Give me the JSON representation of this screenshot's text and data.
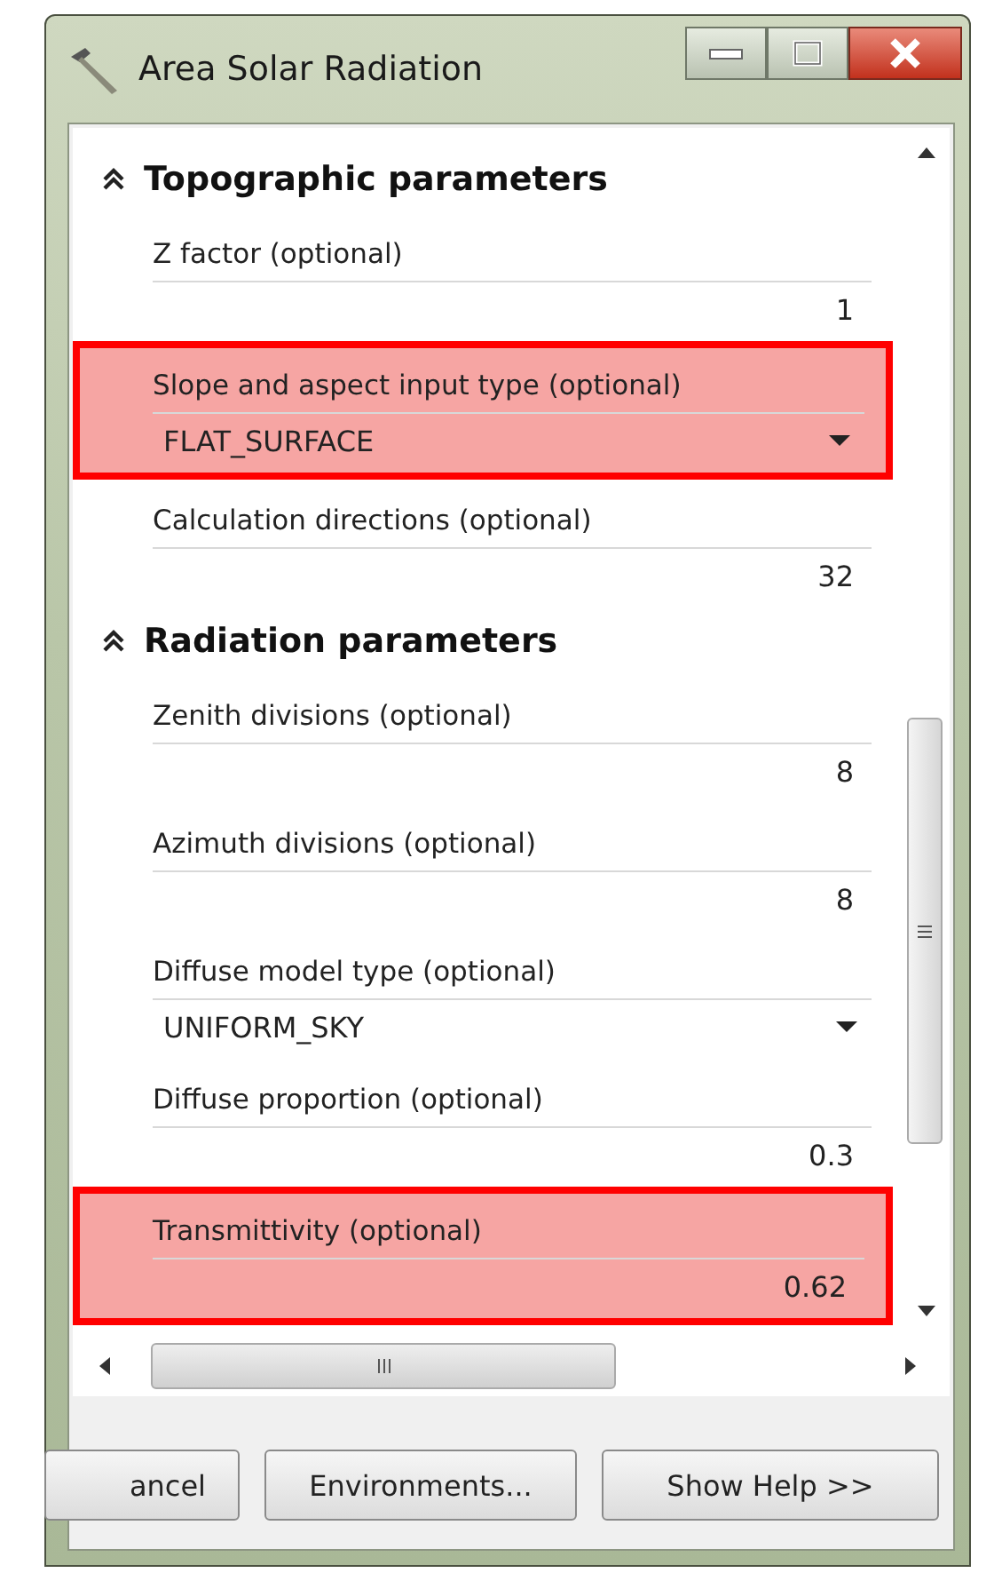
{
  "window": {
    "title": "Area Solar Radiation"
  },
  "sections": [
    {
      "title": "Topographic parameters",
      "expanded": true,
      "params": [
        {
          "label": "Z factor (optional)",
          "kind": "text",
          "value": "1",
          "highlighted": false
        },
        {
          "label": "Slope and aspect input type (optional)",
          "kind": "dropdown",
          "value": "FLAT_SURFACE",
          "highlighted": true
        },
        {
          "label": "Calculation directions (optional)",
          "kind": "text",
          "value": "32",
          "highlighted": false
        }
      ]
    },
    {
      "title": "Radiation parameters",
      "expanded": true,
      "params": [
        {
          "label": "Zenith divisions (optional)",
          "kind": "text",
          "value": "8",
          "highlighted": false
        },
        {
          "label": "Azimuth divisions (optional)",
          "kind": "text",
          "value": "8",
          "highlighted": false
        },
        {
          "label": "Diffuse model type (optional)",
          "kind": "dropdown",
          "value": "UNIFORM_SKY",
          "highlighted": false
        },
        {
          "label": "Diffuse proportion (optional)",
          "kind": "text",
          "value": "0.3",
          "highlighted": false
        },
        {
          "label": "Transmittivity (optional)",
          "kind": "text",
          "value": "0.62",
          "highlighted": true
        }
      ]
    }
  ],
  "buttons": [
    "ancel",
    "Environments...",
    "Show Help >>"
  ]
}
